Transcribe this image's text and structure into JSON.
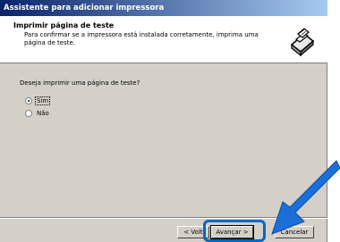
{
  "window": {
    "title": "Assistente para adicionar impressora"
  },
  "header": {
    "title": "Imprimir página de teste",
    "description": "Para confirmar se a impressora está instalada corretamente, imprima uma página de teste.",
    "icon": "printer-icon"
  },
  "content": {
    "question": "Deseja imprimir uma página de teste?",
    "options": [
      {
        "label": "Sim",
        "checked": true
      },
      {
        "label": "Não",
        "checked": false
      }
    ]
  },
  "buttons": {
    "back": "< Volt",
    "next": "Avançar >",
    "cancel": "Cancelar"
  },
  "colors": {
    "title_start": "#0a246a",
    "title_end": "#a6caf0",
    "highlight": "#0068c8",
    "window_bg": "#d4d0c8"
  }
}
